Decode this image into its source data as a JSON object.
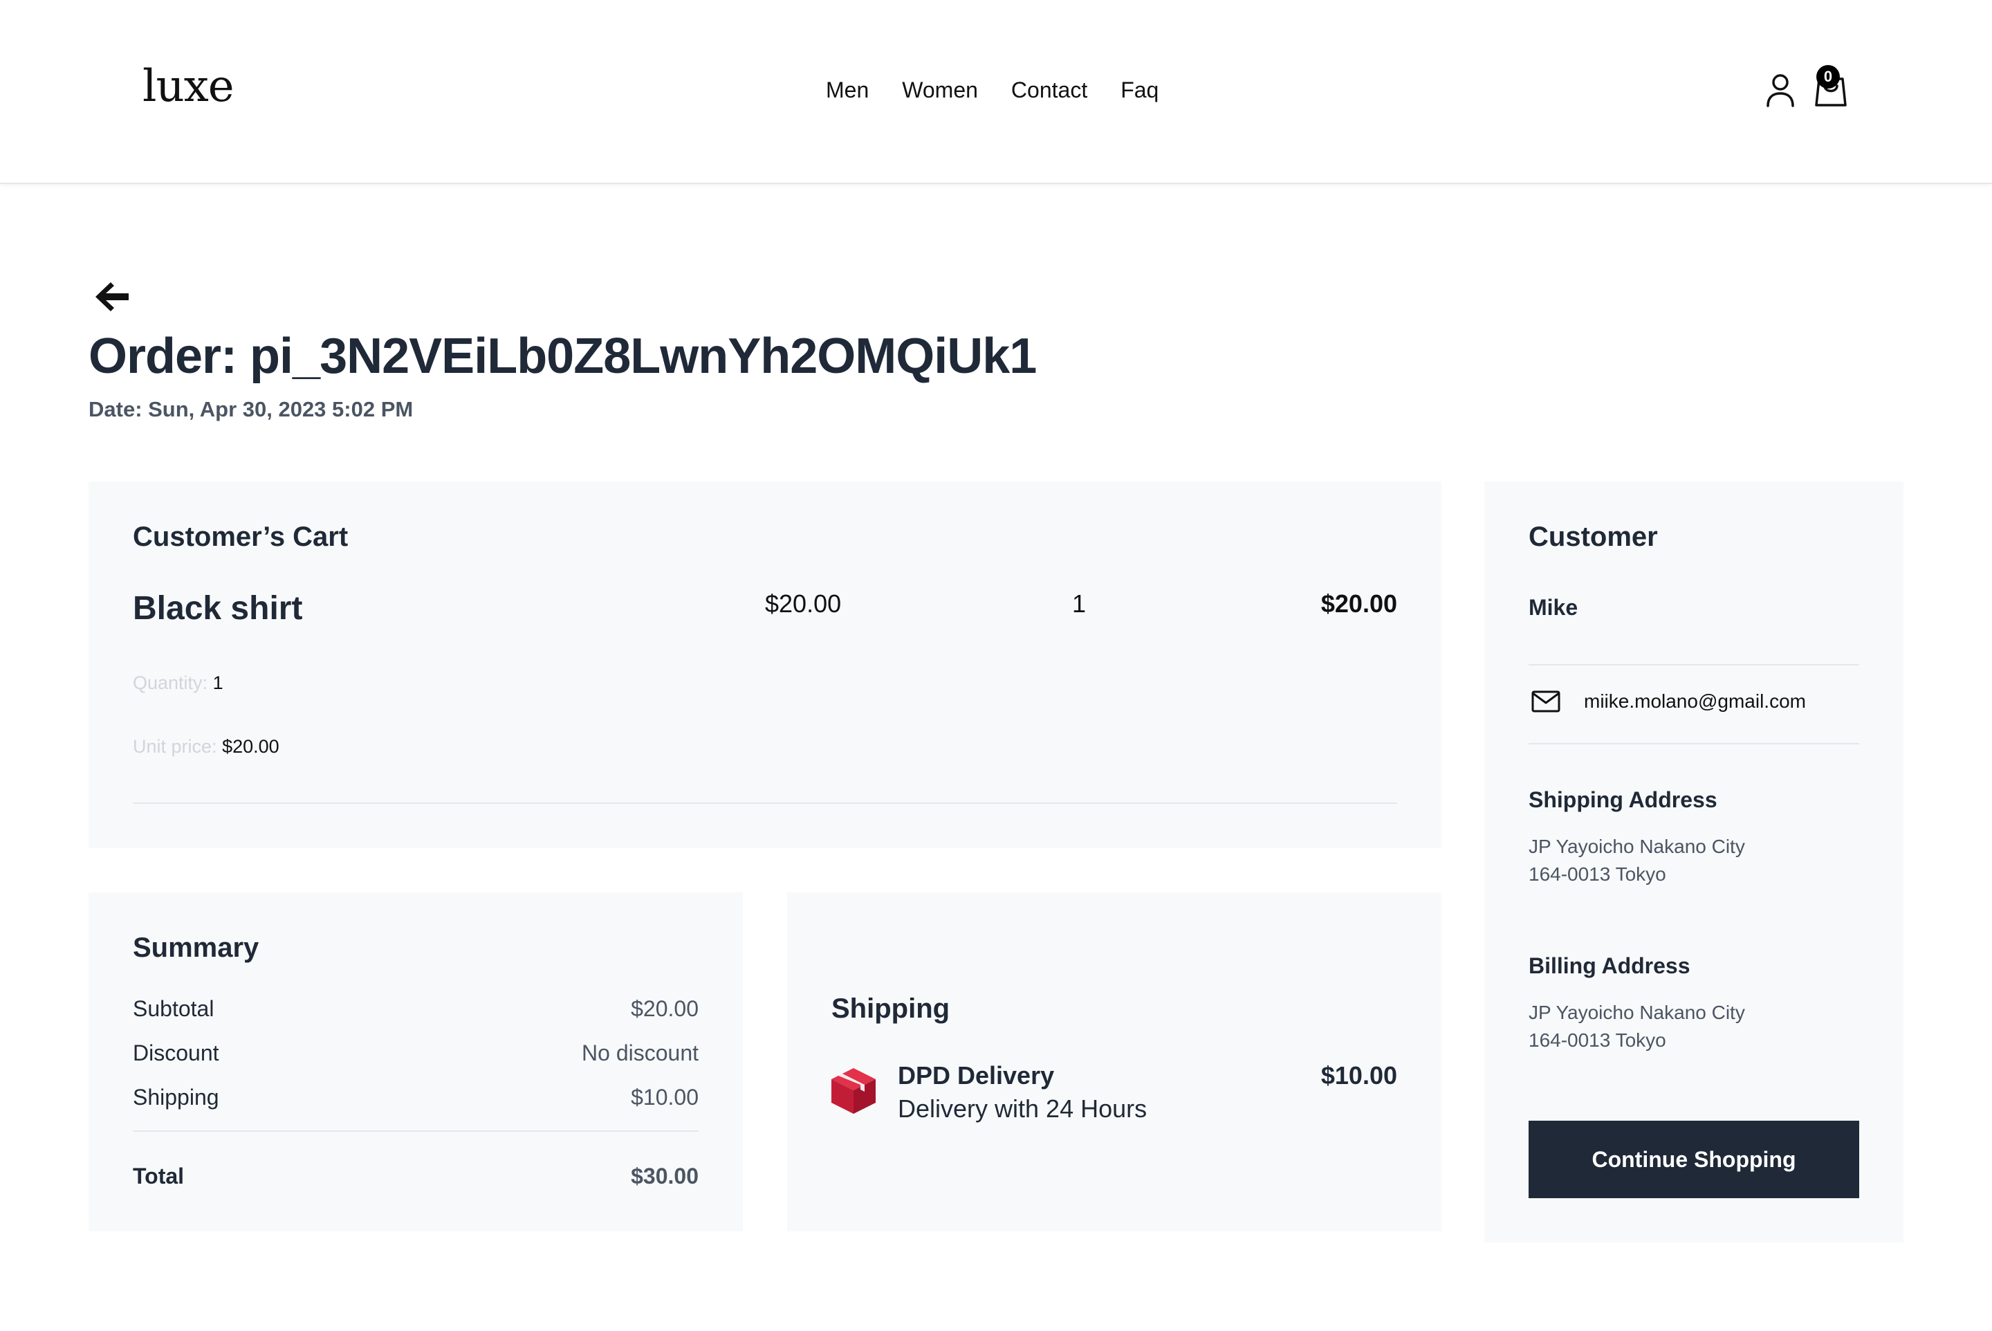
{
  "header": {
    "logo": "luxe",
    "nav": [
      "Men",
      "Women",
      "Contact",
      "Faq"
    ],
    "cart_count": "0"
  },
  "order": {
    "title": "Order: pi_3N2VEiLb0Z8LwnYh2OMQiUk1",
    "date": "Date: Sun, Apr 30, 2023 5:02 PM"
  },
  "cart": {
    "title": "Customer’s Cart",
    "item": {
      "name": "Black shirt",
      "price": "$20.00",
      "quantity": "1",
      "total": "$20.00",
      "quantity_label": "Quantity:",
      "quantity_value": "1",
      "unit_price_label": "Unit price:",
      "unit_price_value": "$20.00"
    }
  },
  "summary": {
    "title": "Summary",
    "rows": [
      {
        "label": "Subtotal",
        "value": "$20.00"
      },
      {
        "label": "Discount",
        "value": "No discount"
      },
      {
        "label": "Shipping",
        "value": "$10.00"
      }
    ],
    "total_label": "Total",
    "total_value": "$30.00"
  },
  "shipping": {
    "title": "Shipping",
    "method": "DPD Delivery",
    "description": "Delivery with 24 Hours",
    "price": "$10.00"
  },
  "customer": {
    "title": "Customer",
    "name": "Mike",
    "email": "miike.molano@gmail.com",
    "shipping_title": "Shipping Address",
    "shipping_lines": [
      "JP Yayoicho Nakano City",
      "164-0013 Tokyo"
    ],
    "billing_title": "Billing Address",
    "billing_lines": [
      "JP Yayoicho Nakano City",
      "164-0013 Tokyo"
    ],
    "continue_label": "Continue Shopping"
  },
  "colors": {
    "primary_button": "#1f2937",
    "card_background": "#f8f9fa",
    "dpd_red": "#dc0032"
  }
}
